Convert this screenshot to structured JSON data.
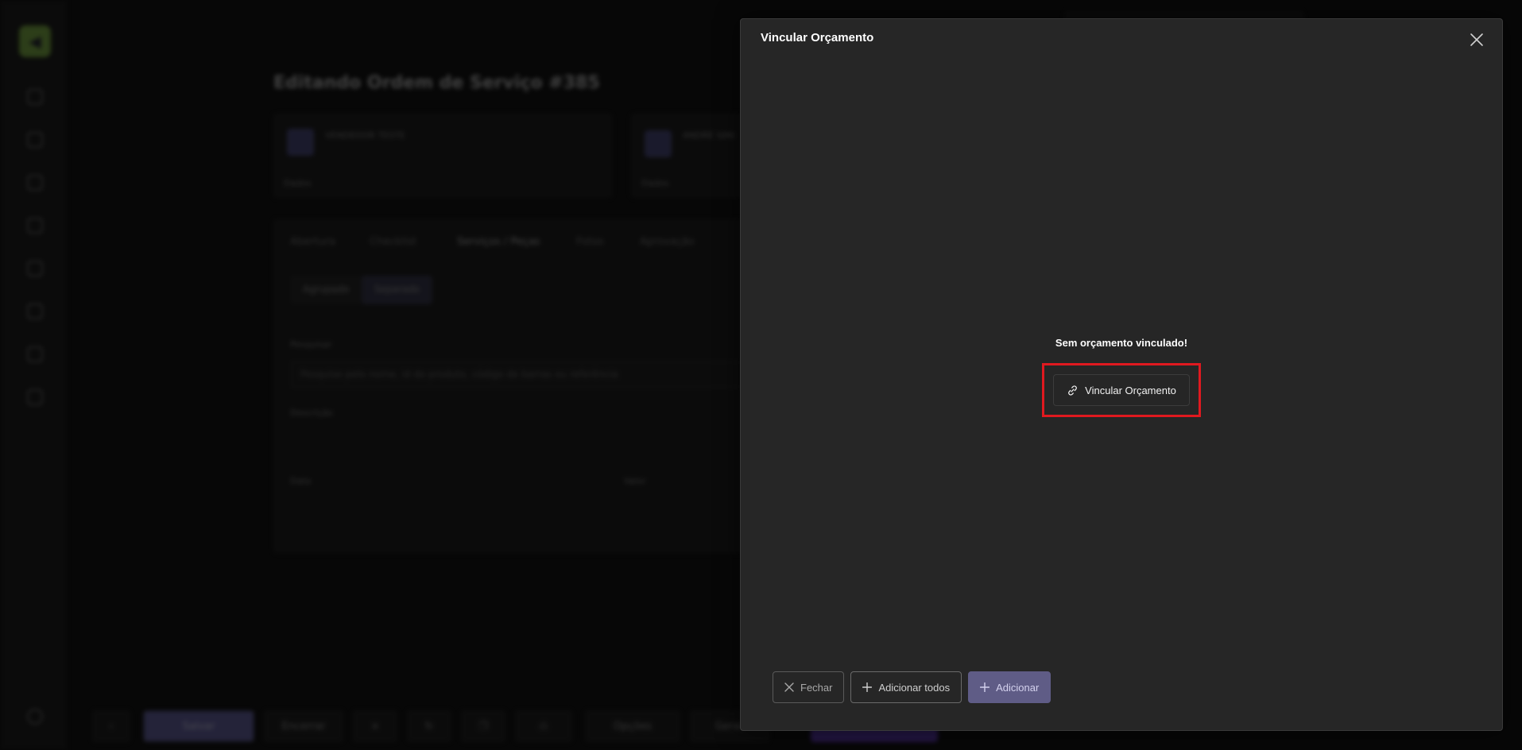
{
  "background": {
    "page_title": "Editando Ordem de Serviço #385",
    "cards": [
      {
        "name": "VENDEDOR TESTE",
        "footer": "Dados"
      },
      {
        "name": "ANDRÉ SAN",
        "footer": "Dados"
      }
    ],
    "tabs": [
      "Abertura",
      "Checklist",
      "Serviços / Peças",
      "Fotos",
      "Aprovação"
    ],
    "toggles": [
      "Agrupado",
      "Separado"
    ],
    "search_label": "Pesquisar",
    "search_placeholder": "Pesquise pelo nome, id do produto, código de barras ou referência",
    "description_label": "Descrição",
    "col_date": "Data",
    "col_value": "Valor",
    "bottom_buttons": [
      "Salvar",
      "Encerrar",
      "Opções",
      "Gerar"
    ]
  },
  "modal": {
    "title": "Vincular Orçamento",
    "empty_message": "Sem orçamento vinculado!",
    "link_button_label": "Vincular Orçamento",
    "footer": {
      "close_label": "Fechar",
      "add_all_label": "Adicionar todos",
      "add_label": "Adicionar"
    }
  },
  "colors": {
    "modal_bg": "#262626",
    "highlight": "#e0191f",
    "primary_button": "#5f5c86",
    "logo_green": "#8bc34a"
  },
  "icons": {
    "close": "close-icon",
    "link": "link-icon",
    "plus": "plus-icon"
  }
}
